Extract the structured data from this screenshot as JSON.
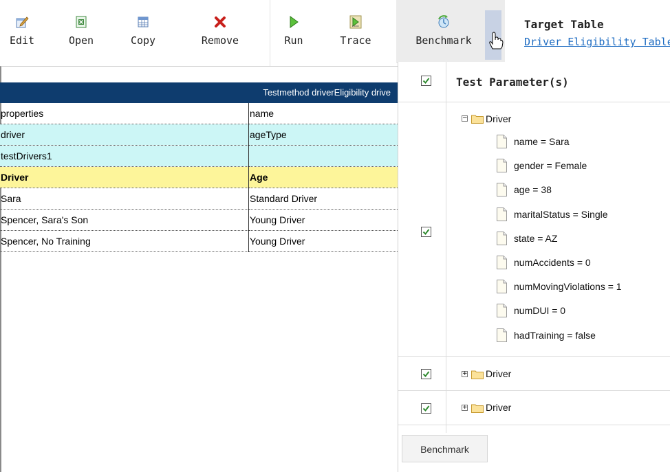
{
  "toolbar": {
    "buttons": [
      {
        "label": "Edit",
        "icon": "edit-icon"
      },
      {
        "label": "Open",
        "icon": "excel-icon"
      },
      {
        "label": "Copy",
        "icon": "table-copy-icon"
      },
      {
        "label": "Remove",
        "icon": "remove-x-icon"
      },
      {
        "label": "Run",
        "icon": "run-play-icon"
      },
      {
        "label": "Trace",
        "icon": "trace-icon"
      },
      {
        "label": "Benchmark",
        "icon": "benchmark-icon"
      }
    ],
    "target_title": "Target Table",
    "target_link": "Driver Eligibility Table"
  },
  "test_table": {
    "header": "Testmethod driverEligibility drive",
    "rows": [
      {
        "c1": "properties",
        "c2": "name",
        "style": "plain"
      },
      {
        "c1": "driver",
        "c2": "ageType",
        "style": "cyan"
      },
      {
        "c1": "testDrivers1",
        "c2": "",
        "style": "cyan"
      },
      {
        "c1": "Driver",
        "c2": "Age",
        "style": "yellow"
      },
      {
        "c1": "Sara",
        "c2": "Standard Driver",
        "style": "plain"
      },
      {
        "c1": "Spencer, Sara's Son",
        "c2": "Young Driver",
        "style": "plain"
      },
      {
        "c1": "Spencer, No Training",
        "c2": "Young Driver",
        "style": "plain"
      }
    ]
  },
  "panel": {
    "title": "Test Parameter(s)",
    "tree1": {
      "root": "Driver",
      "expander": "−",
      "children": [
        "name = Sara",
        "gender = Female",
        "age = 38",
        "maritalStatus = Single",
        "state = AZ",
        "numAccidents = 0",
        "numMovingViolations = 1",
        "numDUI = 0",
        "hadTraining = false"
      ]
    },
    "tree2": {
      "root": "Driver",
      "expander": "+"
    },
    "tree3": {
      "root": "Driver",
      "expander": "+"
    },
    "benchmark_button": "Benchmark"
  },
  "colors": {
    "header_navy": "#0e3c6e",
    "row_cyan": "#ccf6f6",
    "row_yellow": "#fdf59a",
    "link_blue": "#1e6cc2",
    "checkbox_green": "#2f8a2f"
  }
}
